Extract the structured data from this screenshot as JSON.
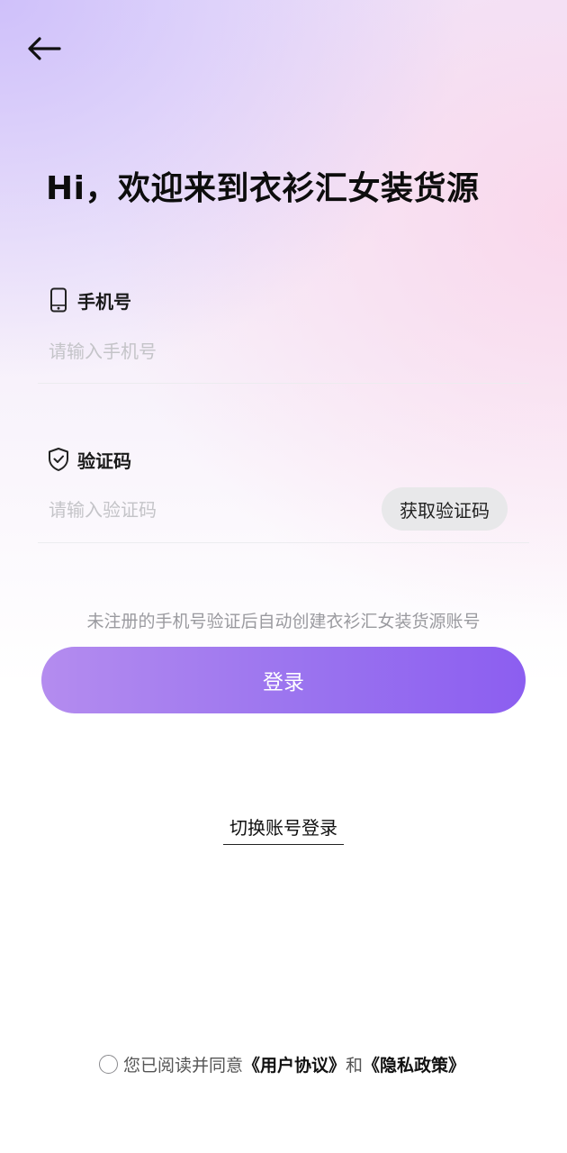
{
  "header": {
    "back_icon": "arrow-left-icon",
    "title": "Hi，欢迎来到衣衫汇女装货源"
  },
  "phone_field": {
    "icon": "phone-icon",
    "label": "手机号",
    "placeholder": "请输入手机号",
    "value": ""
  },
  "code_field": {
    "icon": "shield-check-icon",
    "label": "验证码",
    "placeholder": "请输入验证码",
    "value": "",
    "get_code_label": "获取验证码"
  },
  "hint": "未注册的手机号验证后自动创建衣衫汇女装货源账号",
  "login_button": "登录",
  "switch_account_link": "切换账号登录",
  "agreement": {
    "checked": false,
    "prefix": "您已阅读并同意",
    "user_agreement": "《用户协议》",
    "conjunction": "和",
    "privacy_policy": "《隐私政策》"
  },
  "colors": {
    "accent_start": "#b48cef",
    "accent_end": "#8c5ef0",
    "title": "#0d0d0d",
    "placeholder": "#c4c4c8",
    "hint": "#9a9a9f"
  }
}
